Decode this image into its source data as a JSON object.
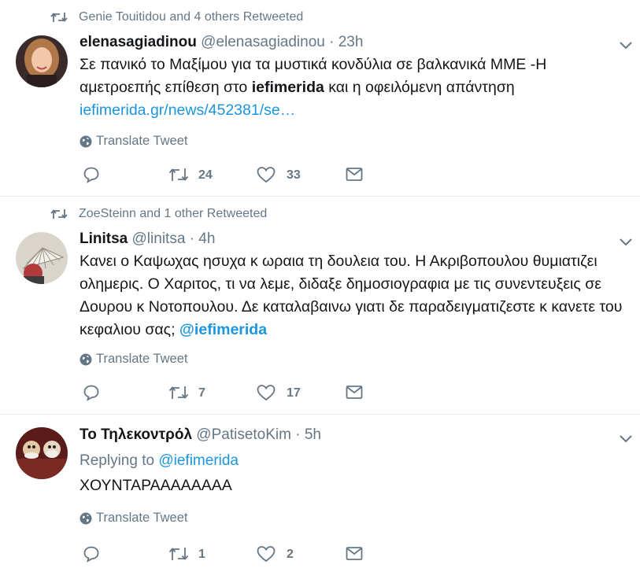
{
  "tweets": [
    {
      "context": "Genie Touitidou and 4 others Retweeted",
      "fullname": "elenasagiadinou",
      "handle": "@elenasagiadinou",
      "dot": "·",
      "time": "23h",
      "text_part1": "Σε πανικό το Μαξίμου για τα μυστικά κονδύλια σε βαλκανικά ΜΜΕ -Η αμετροεπής επίθεση στο ",
      "text_bold": "iefimerida",
      "text_part2": " και η οφειλόμενη απάντηση ",
      "link": "iefimerida.gr/news/452381/se…",
      "translate": "Translate Tweet",
      "retweets": "24",
      "likes": "33",
      "avatar_icon": "avatar-woman-photo"
    },
    {
      "context": "ZoeSteinn and 1 other Retweeted",
      "fullname": "Linitsa",
      "handle": "@linitsa",
      "dot": "·",
      "time": "4h",
      "text_part1": "Κανει ο Καψωχας ησυχα κ ωραια τη δουλεια του. Η Ακριβοπουλου θυμιατιζει ολημερις. Ο Χαριτος, τι να λεμε, διδαξε δημοσιογραφια με τις συνεντευξεις σε Δουρου κ Νοτοπουλου. Δε καταλαβαινω γιατι δε παραδειγματιζεστε κ κανετε του κεφαλιου σας; ",
      "mention": "@iefimerida",
      "translate": "Translate Tweet",
      "retweets": "7",
      "likes": "17",
      "avatar_icon": "avatar-fan-photo"
    },
    {
      "fullname": "Το Τηλεκοντρόλ",
      "handle": "@PatisetoKim",
      "dot": "·",
      "time": "5h",
      "replying_prefix": "Replying to ",
      "replying_to": "@iefimerida",
      "text_part1": "ΧΟΥΝΤΑΡΑΑΑΑΑΑΑΑ",
      "translate": "Translate Tweet",
      "retweets": "1",
      "likes": "2",
      "avatar_icon": "avatar-muppets-photo"
    }
  ],
  "colors": {
    "text": "#14171a",
    "secondary": "#657786",
    "link": "#1b95e0",
    "divider": "#e6ecf0"
  },
  "icons": {
    "retweet": "retweet-icon",
    "reply": "reply-icon",
    "like": "heart-icon",
    "dm": "envelope-icon",
    "caret": "chevron-down-icon",
    "translate": "globe-icon"
  }
}
